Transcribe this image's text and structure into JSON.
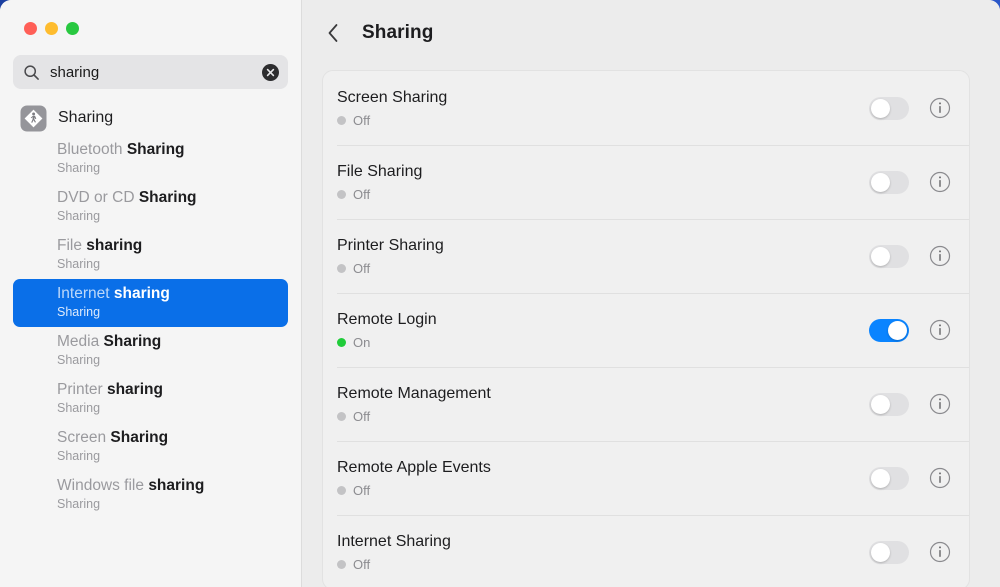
{
  "window": {
    "traffic_lights": [
      {
        "name": "close",
        "color": "#ff5f57"
      },
      {
        "name": "minimize",
        "color": "#febc2e"
      },
      {
        "name": "maximize",
        "color": "#28c840"
      }
    ]
  },
  "sidebar": {
    "search": {
      "value": "sharing",
      "placeholder": "Search",
      "icon": "search-icon",
      "clear_icon": "clear-circle-icon"
    },
    "results_header": {
      "label": "Sharing",
      "icon": "sharing-app-icon"
    },
    "results": [
      {
        "pre": "Bluetooth ",
        "match": "Sharing",
        "post": "",
        "subtitle": "Sharing",
        "selected": false
      },
      {
        "pre": "DVD or CD ",
        "match": "Sharing",
        "post": "",
        "subtitle": "Sharing",
        "selected": false
      },
      {
        "pre": "File ",
        "match": "sharing",
        "post": "",
        "subtitle": "Sharing",
        "selected": false
      },
      {
        "pre": "Internet ",
        "match": "sharing",
        "post": "",
        "subtitle": "Sharing",
        "selected": true
      },
      {
        "pre": "Media ",
        "match": "Sharing",
        "post": "",
        "subtitle": "Sharing",
        "selected": false
      },
      {
        "pre": "Printer ",
        "match": "sharing",
        "post": "",
        "subtitle": "Sharing",
        "selected": false
      },
      {
        "pre": "Screen ",
        "match": "Sharing",
        "post": "",
        "subtitle": "Sharing",
        "selected": false
      },
      {
        "pre": "Windows file ",
        "match": "sharing",
        "post": "",
        "subtitle": "Sharing",
        "selected": false
      }
    ]
  },
  "main": {
    "back_icon": "chevron-left-icon",
    "title": "Sharing",
    "rows": [
      {
        "name": "Screen Sharing",
        "status": "Off",
        "on": false,
        "info_icon": "info-circle-icon"
      },
      {
        "name": "File Sharing",
        "status": "Off",
        "on": false,
        "info_icon": "info-circle-icon"
      },
      {
        "name": "Printer Sharing",
        "status": "Off",
        "on": false,
        "info_icon": "info-circle-icon"
      },
      {
        "name": "Remote Login",
        "status": "On",
        "on": true,
        "info_icon": "info-circle-icon"
      },
      {
        "name": "Remote Management",
        "status": "Off",
        "on": false,
        "info_icon": "info-circle-icon"
      },
      {
        "name": "Remote Apple Events",
        "status": "Off",
        "on": false,
        "info_icon": "info-circle-icon"
      },
      {
        "name": "Internet Sharing",
        "status": "Off",
        "on": false,
        "info_icon": "info-circle-icon"
      }
    ]
  },
  "colors": {
    "accent_blue": "#0a6fe8",
    "toggle_on": "#0a84ff",
    "status_on_green": "#20cc3a",
    "status_off_gray": "#c3c3c5",
    "sidebar_bg": "#f5f5f5",
    "main_bg": "#ececec"
  }
}
